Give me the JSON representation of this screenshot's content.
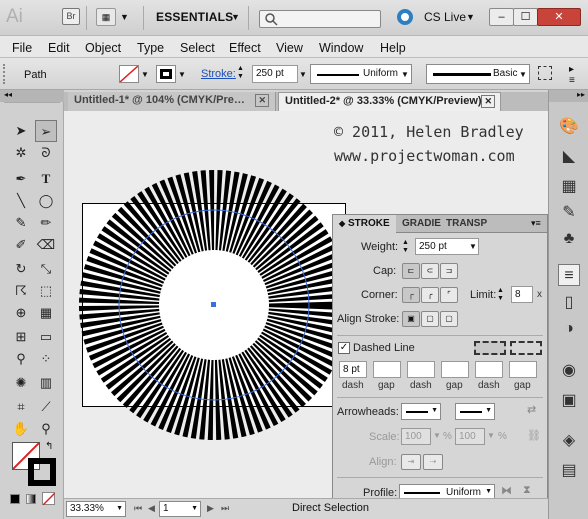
{
  "app": {
    "logo": "Ai",
    "bridge": "Br",
    "workspace": "ESSENTIALS",
    "cs_live": "CS Live"
  },
  "window_controls": {
    "minimize": "–",
    "restore": "☐",
    "close": "✕"
  },
  "menu": [
    "File",
    "Edit",
    "Object",
    "Type",
    "Select",
    "Effect",
    "View",
    "Window",
    "Help"
  ],
  "control_bar": {
    "selection": "Path",
    "stroke_label": "Stroke:",
    "stroke_value": "250 pt",
    "profile": "Uniform",
    "brush": "Basic"
  },
  "tabs": [
    {
      "label": "Untitled-1* @ 104% (CMYK/Pre…",
      "active": false
    },
    {
      "label": "Untitled-2* @ 33.33% (CMYK/Preview)",
      "active": true
    }
  ],
  "watermark": {
    "line1": "© 2011, Helen Bradley",
    "line2": "www.projectwoman.com"
  },
  "stroke_panel": {
    "tabs": [
      "STROKE",
      "GRADIE",
      "TRANSP"
    ],
    "weight_label": "Weight:",
    "weight_value": "250 pt",
    "cap_label": "Cap:",
    "corner_label": "Corner:",
    "limit_label": "Limit:",
    "limit_value": "8",
    "limit_unit": "x",
    "align_label": "Align Stroke:",
    "dashed_label": "Dashed Line",
    "dashed_checked": true,
    "dash_values": [
      "8 pt",
      "",
      "",
      "",
      "",
      ""
    ],
    "dash_labels": [
      "dash",
      "gap",
      "dash",
      "gap",
      "dash",
      "gap"
    ],
    "arrowheads_label": "Arrowheads:",
    "scale_label": "Scale:",
    "scale_1": "100",
    "scale_2": "100",
    "percent": "%",
    "align_arrow_label": "Align:",
    "profile_label": "Profile:",
    "profile_value": "Uniform"
  },
  "status": {
    "zoom": "33.33%",
    "page": "1",
    "tool": "Direct Selection"
  },
  "colors": {
    "accent": "#2d7fc1",
    "path": "#3a6fe0"
  }
}
